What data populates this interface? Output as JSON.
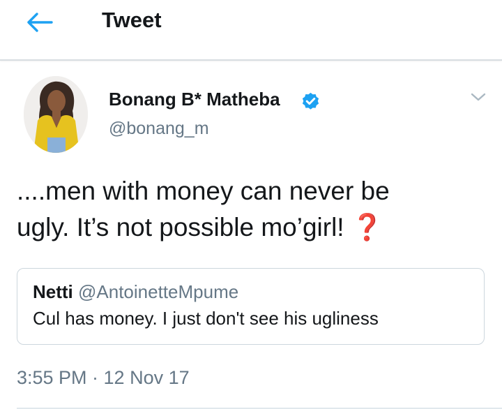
{
  "header": {
    "title": "Tweet",
    "back_icon": "back-arrow-icon",
    "accent_color": "#1da1f2"
  },
  "tweet": {
    "author_name": "Bonang B* Matheba",
    "author_handle": "@bonang_m",
    "verified_icon": "verified-badge-icon",
    "menu_icon": "chevron-down-icon",
    "text_lines": [
      "....men with money can never be",
      "ugly. It’s not possible mo’girl! ❓"
    ],
    "timestamp": "3:55 PM · 12 Nov 17"
  },
  "quoted_tweet": {
    "author_name": "Netti",
    "author_handle": "@AntoinetteMpume",
    "text": "Cul has money. I just don't see his ugliness"
  }
}
